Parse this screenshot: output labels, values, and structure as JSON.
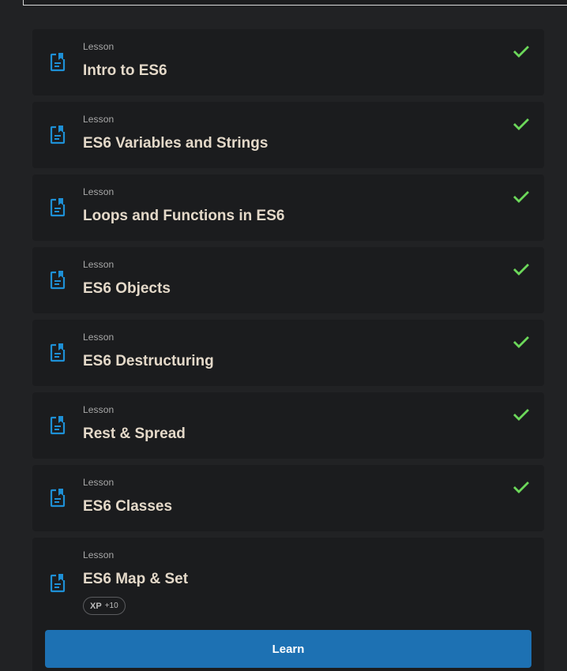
{
  "lessons": [
    {
      "kind": "Lesson",
      "title": "Intro to ES6",
      "completed": true
    },
    {
      "kind": "Lesson",
      "title": "ES6 Variables and Strings",
      "completed": true
    },
    {
      "kind": "Lesson",
      "title": "Loops and Functions in ES6",
      "completed": true
    },
    {
      "kind": "Lesson",
      "title": "ES6 Objects",
      "completed": true
    },
    {
      "kind": "Lesson",
      "title": "ES6 Destructuring",
      "completed": true
    },
    {
      "kind": "Lesson",
      "title": "Rest & Spread",
      "completed": true
    },
    {
      "kind": "Lesson",
      "title": "ES6 Classes",
      "completed": true
    }
  ],
  "current_lesson": {
    "kind": "Lesson",
    "title": "ES6 Map & Set",
    "xp_label": "XP",
    "xp_value": "+10",
    "button_label": "Learn"
  },
  "icons": {
    "lesson": "document-icon",
    "completed": "check-icon"
  },
  "colors": {
    "page_bg": "#212224",
    "card_bg": "#1b1c1e",
    "icon_blue": "#1e90d6",
    "check_green": "#6cd85a",
    "button_blue": "#1d71b3",
    "title_text": "#e4d9c9"
  }
}
